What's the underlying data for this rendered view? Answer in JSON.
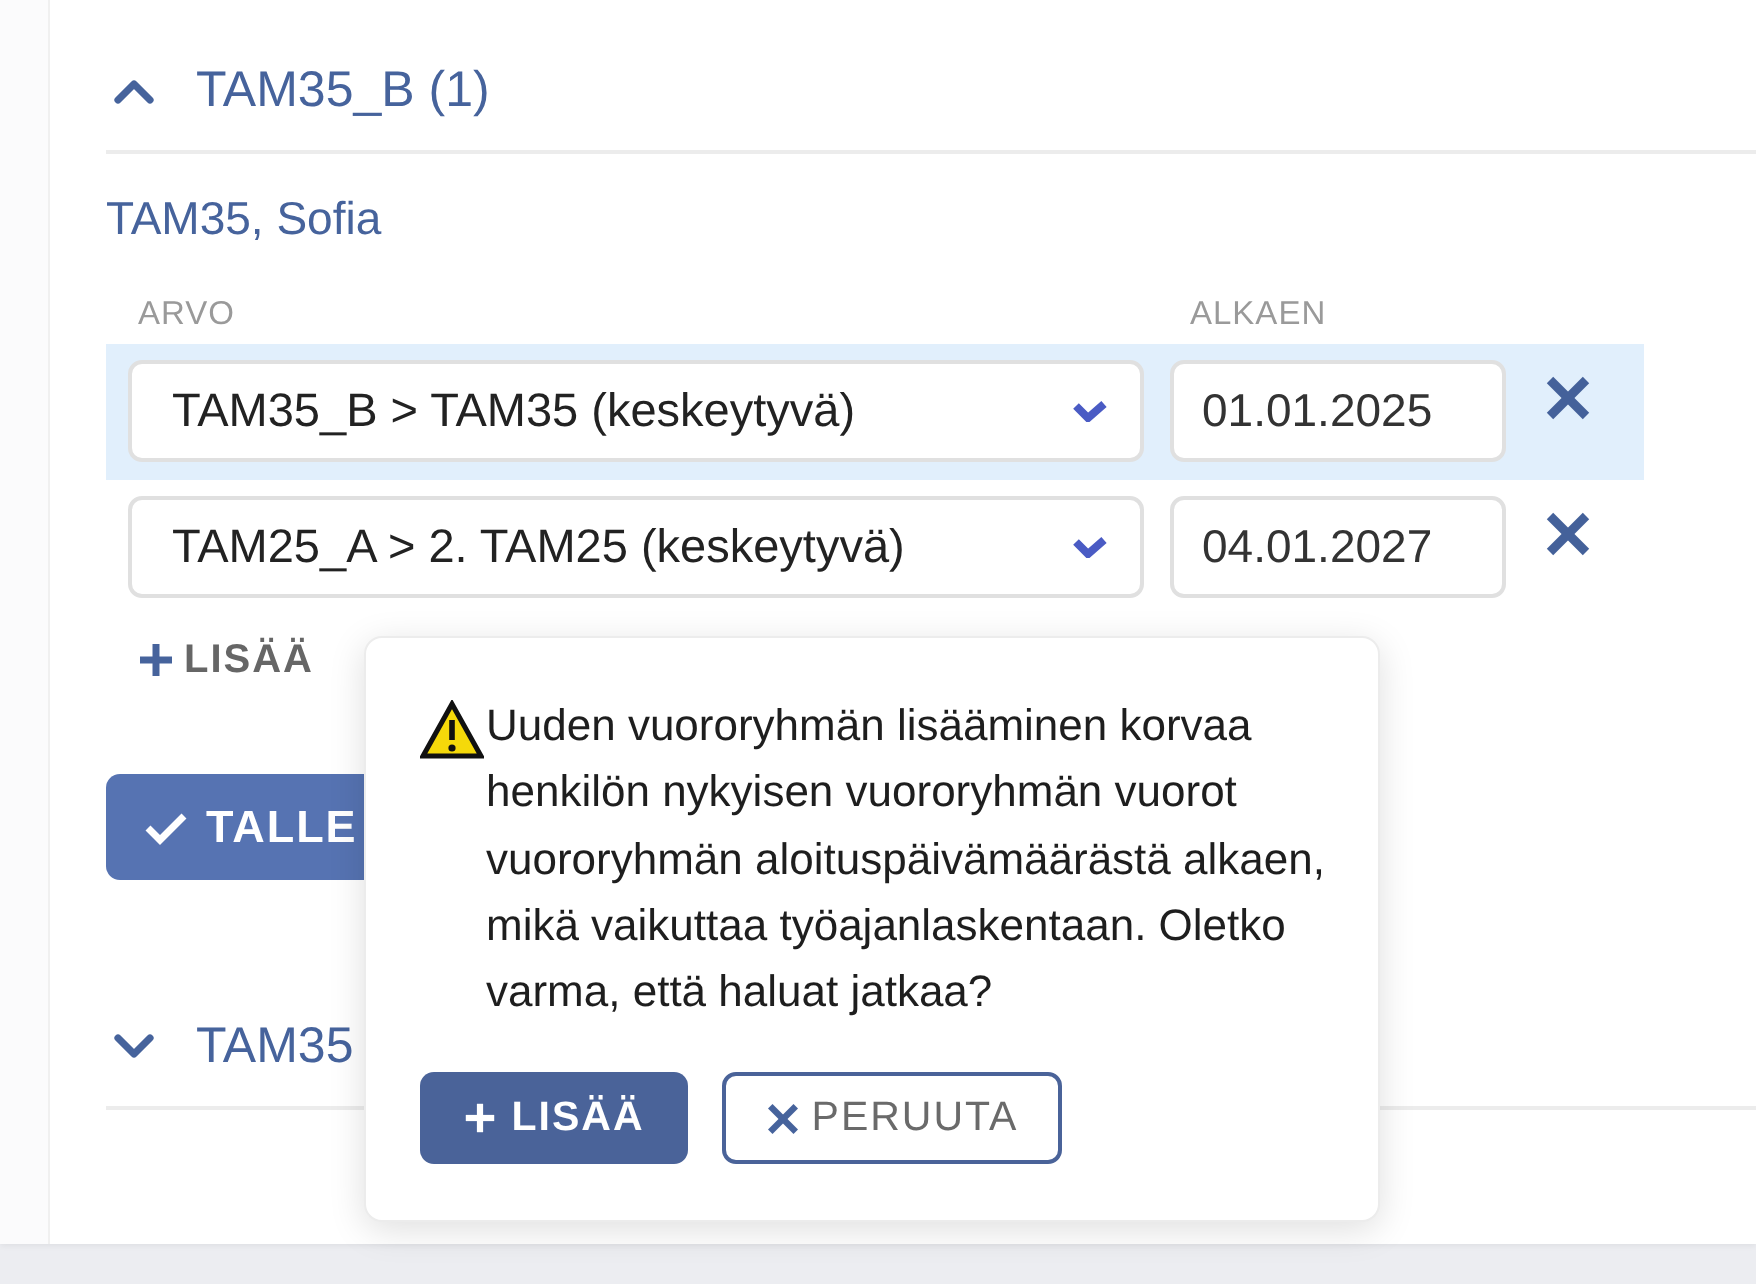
{
  "sections": [
    {
      "title": "TAM35_B (1)",
      "expanded": true,
      "person": "TAM35, Sofia",
      "columns": [
        "ARVO",
        "ALKAEN"
      ],
      "rows": [
        {
          "value": "TAM35_B > TAM35 (keskeytyvä)",
          "start": "01.01.2025",
          "selected": true
        },
        {
          "value": "TAM25_A > 2. TAM25 (keskeytyvä)",
          "start": "04.01.2027",
          "selected": false
        }
      ],
      "add_label": "LISÄÄ",
      "save_label": "TALLE"
    },
    {
      "title": "TAM35",
      "expanded": false
    }
  ],
  "popover": {
    "message": "Uuden vuororyhmän lisääminen korvaa henkilön nykyisen vuororyhmän vuorot vuororyhmän aloituspäivämäärästä alkaen, mikä vaikuttaa työajanlaskentaan. Oletko varma, että haluat jatkaa?",
    "confirm": "LISÄÄ",
    "cancel": "PERUUTA"
  }
}
